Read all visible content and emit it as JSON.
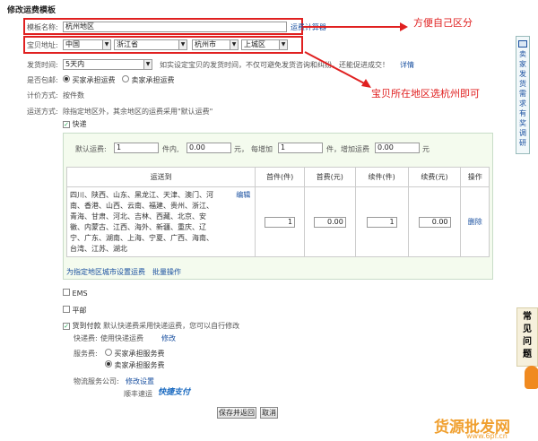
{
  "page": {
    "title": "修改运费模板"
  },
  "form": {
    "template_name_label": "模板名称:",
    "template_name_value": "杭州地区",
    "template_name_link": "运费计算器",
    "address_label": "宝贝地址:",
    "country": "中国",
    "province": "浙江省",
    "city": "杭州市",
    "district": "上城区",
    "ship_time_label": "发货时间:",
    "ship_time_value": "5天内",
    "ship_time_hint": "如实设定宝贝的发货时间，不仅可避免发货咨询和纠纷，还能促进成交！",
    "ship_time_link": "详情",
    "free_label": "是否包邮:",
    "free_opt1": "买家承担运费",
    "free_opt2": "卖家承担运费",
    "pricing_label": "计价方式:",
    "pricing_value": "按件数",
    "method_label": "运送方式:",
    "method_hint": "除指定地区外，其余地区的运费采用\"默认运费\"",
    "express_label": "快递",
    "default_fee_label": "默认运费:",
    "default_qty": "1",
    "unit1": "件内,",
    "default_fee": "0.00",
    "unit2": "元，",
    "each_add_label": "每增加",
    "each_add_qty": "1",
    "unit3": "件，",
    "add_fee_label": "增加运费",
    "add_fee": "0.00",
    "unit4": "元",
    "table_headers": [
      "运送到",
      "首件(件)",
      "首费(元)",
      "续件(件)",
      "续费(元)",
      "操作"
    ],
    "row_regions": "四川、陕西、山东、黑龙江、天津、福建、贵州、浙江、青海、甘肃、河北、吉林、西藏、北京、安徽、内蒙古、江西、海外、新疆、重庆、辽宁、广东、湖南、上海、宁夏、广西、海南、台湾、江苏、湖北",
    "row_regions_l1": "四川、陕西、山东、黑龙江、天津、澳门、河",
    "row_regions_l2": "南、香港、山西、云南、福建、贵州、浙江、",
    "row_regions_l3": "青海、甘肃、河北、吉林、西藏、北京、安",
    "row_regions_l4": "徽、内蒙古、江西、海外、新疆、重庆、辽",
    "row_regions_l5": "宁、广东、湖南、上海、宁夏、广西、海南、",
    "row_regions_l6": "台湾、江苏、湖北",
    "row_edit": "编辑",
    "row_first_qty": "1",
    "row_first_fee": "0.00",
    "row_next_qty": "1",
    "row_next_fee": "0.00",
    "row_delete": "删除",
    "set_region_link": "为指定地区城市设置运费",
    "batch_link": "批量操作",
    "ems_label": "EMS",
    "post_label": "平邮",
    "cod_label": "货到付款",
    "cod_hint": "默认快递费采用快递运费，您可以自行修改",
    "express_fee_label": "快递费:",
    "express_fee_value": "使用快递运费",
    "express_fee_link": "修改",
    "service_label": "服务费:",
    "service_opt1": "买家承担服务费",
    "service_opt2": "卖家承担服务费",
    "logistics_label": "物流服务公司:",
    "logistics_link": "修改设置",
    "logistics_value": "顺丰速运",
    "logistics_logo": "快捷支付",
    "save_button": "保存并返回",
    "cancel_button": "取消"
  },
  "annotations": {
    "note1": "方便自己区分",
    "note2": "宝贝所在地区选杭州即可"
  },
  "side": {
    "survey": "卖家发货需求有奖调研",
    "faq": "常见问题"
  },
  "watermark": {
    "text": "货源批发网",
    "url": "www.6pf.cn"
  },
  "colors": {
    "annotation": "#e02020",
    "link": "#1a50a0"
  }
}
